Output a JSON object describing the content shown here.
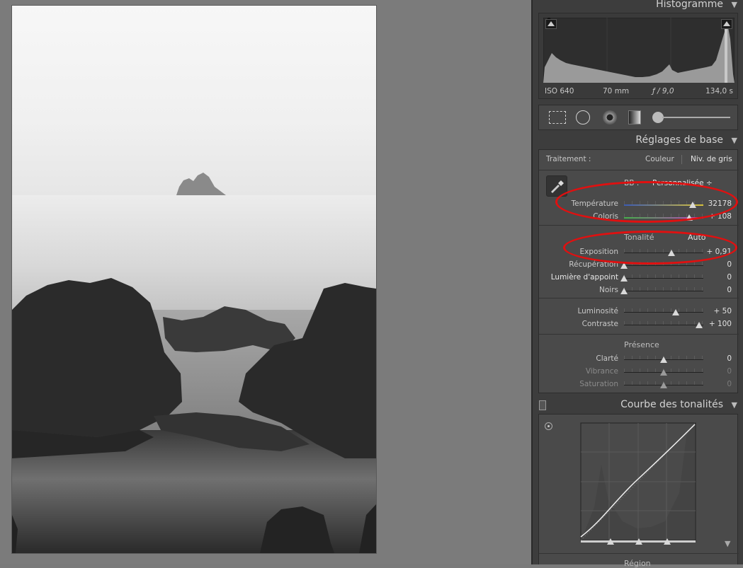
{
  "histogram": {
    "title": "Histogramme",
    "iso": "ISO 640",
    "focal": "70 mm",
    "aperture": "ƒ / 9,0",
    "shutter": "134,0 s"
  },
  "basic": {
    "title": "Réglages de base",
    "treatment_label": "Traitement :",
    "treatment_color": "Couleur",
    "treatment_gray": "Niv. de gris",
    "wb_label": "BB :",
    "wb_value": "Personnalisée ÷",
    "tone_label": "Tonalité",
    "auto_label": "Auto",
    "presence_label": "Présence",
    "sliders": {
      "temperature": {
        "label": "Température",
        "value": "32178",
        "pos": 0.87
      },
      "tint": {
        "label": "Coloris",
        "value": "+ 108",
        "pos": 0.82
      },
      "exposure": {
        "label": "Exposition",
        "value": "+ 0,91",
        "pos": 0.6
      },
      "recovery": {
        "label": "Récupération",
        "value": "0",
        "pos": 0.0
      },
      "fill": {
        "label": "Lumière d'appoint",
        "value": "0",
        "pos": 0.0
      },
      "blacks": {
        "label": "Noirs",
        "value": "0",
        "pos": 0.0
      },
      "brightness": {
        "label": "Luminosité",
        "value": "+ 50",
        "pos": 0.65
      },
      "contrast": {
        "label": "Contraste",
        "value": "+ 100",
        "pos": 0.95
      },
      "clarity": {
        "label": "Clarté",
        "value": "0",
        "pos": 0.5
      },
      "vibrance": {
        "label": "Vibrance",
        "value": "0",
        "pos": 0.5
      },
      "saturation": {
        "label": "Saturation",
        "value": "0",
        "pos": 0.5
      }
    }
  },
  "tonecurve": {
    "title": "Courbe des tonalités",
    "region_label": "Région"
  },
  "icons": {
    "crop": "crop-grid-icon",
    "spot": "spot-removal-icon",
    "redeye": "red-eye-icon",
    "gradient": "graduated-filter-icon",
    "brush": "adjustment-brush-icon"
  },
  "colors": {
    "annotation": "#e01010",
    "panel": "#3d3d3d"
  }
}
